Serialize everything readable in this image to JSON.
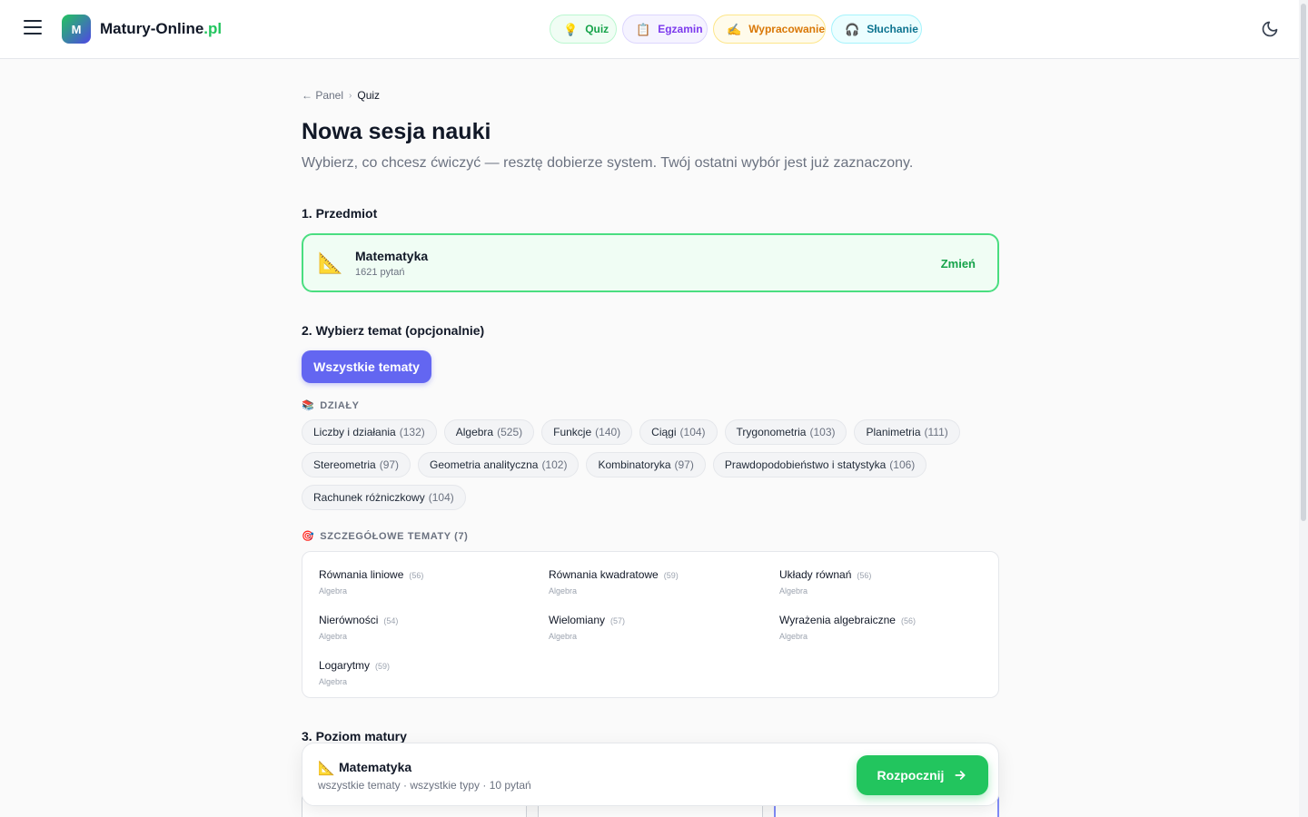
{
  "header": {
    "logo_letter": "M",
    "logo_name": "Matury-Online",
    "logo_tld": ".pl",
    "nav": {
      "quiz": "Quiz",
      "exam": "Egzamin",
      "essay": "Wypracowanie",
      "listening": "Słuchanie"
    }
  },
  "breadcrumb": {
    "back": "← Panel",
    "current": "Quiz"
  },
  "page": {
    "title": "Nowa sesja nauki",
    "subtitle": "Wybierz, co chcesz ćwiczyć — resztę dobierze system. Twój ostatni wybór jest już zaznaczony."
  },
  "step1": {
    "label": "1. Przedmiot",
    "subject_name": "Matematyka",
    "subject_count": "1621 pytań",
    "change": "Zmień"
  },
  "step2": {
    "label": "2. Wybierz temat (opcjonalnie)",
    "all_topics": "Wszystkie tematy",
    "sections_label": "DZIAŁY",
    "sections": [
      {
        "name": "Liczby i działania",
        "count": "(132)"
      },
      {
        "name": "Algebra",
        "count": "(525)"
      },
      {
        "name": "Funkcje",
        "count": "(140)"
      },
      {
        "name": "Ciągi",
        "count": "(104)"
      },
      {
        "name": "Trygonometria",
        "count": "(103)"
      },
      {
        "name": "Planimetria",
        "count": "(111)"
      },
      {
        "name": "Stereometria",
        "count": "(97)"
      },
      {
        "name": "Geometria analityczna",
        "count": "(102)"
      },
      {
        "name": "Kombinatoryka",
        "count": "(97)"
      },
      {
        "name": "Prawdopodobieństwo i statystyka",
        "count": "(106)"
      },
      {
        "name": "Rachunek różniczkowy",
        "count": "(104)"
      }
    ],
    "detailed_label": "SZCZEGÓŁOWE TEMATY (7)",
    "detailed": [
      {
        "name": "Równania liniowe",
        "count": "(56)",
        "section": "Algebra"
      },
      {
        "name": "Równania kwadratowe",
        "count": "(59)",
        "section": "Algebra"
      },
      {
        "name": "Układy równań",
        "count": "(56)",
        "section": "Algebra"
      },
      {
        "name": "Nierówności",
        "count": "(54)",
        "section": "Algebra"
      },
      {
        "name": "Wielomiany",
        "count": "(57)",
        "section": "Algebra"
      },
      {
        "name": "Wyrażenia algebraiczne",
        "count": "(56)",
        "section": "Algebra"
      },
      {
        "name": "Logarytmy",
        "count": "(59)",
        "section": "Algebra"
      }
    ]
  },
  "step3": {
    "label": "3. Poziom matury"
  },
  "bottom_bar": {
    "subject": "Matematyka",
    "meta": "wszystkie tematy · wszystkie typy · 10 pytań",
    "start": "Rozpocznij"
  }
}
